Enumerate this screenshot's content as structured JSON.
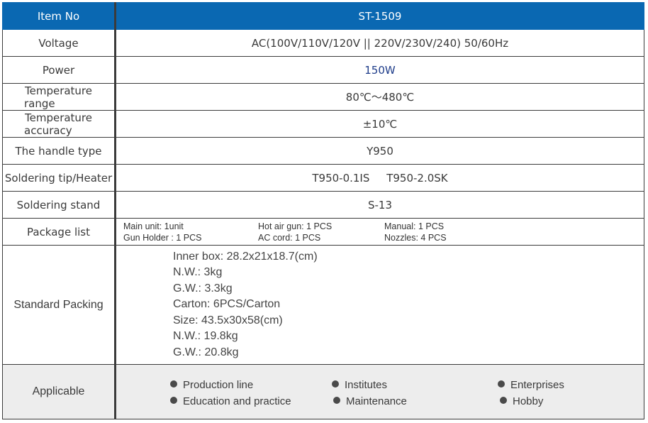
{
  "rows": {
    "item_no": {
      "label": "Item No",
      "value": "ST-1509"
    },
    "voltage": {
      "label": "Voltage",
      "value": "AC(100V/110V/120V || 220V/230V/240)  50/60Hz"
    },
    "power": {
      "label": "Power",
      "value": "150W"
    },
    "temp_range": {
      "label_line1": "Temperature",
      "label_line2": "range",
      "value": "80℃～480℃"
    },
    "temp_accuracy": {
      "label_line1": "Temperature",
      "label_line2": "accuracy",
      "value": "±10℃"
    },
    "handle_type": {
      "label": "The handle type",
      "value": "Y950"
    },
    "soldering_tip": {
      "label": "Soldering tip/Heater",
      "value": "T950-0.1IS     T950-2.0SK"
    },
    "soldering_stand": {
      "label": "Soldering stand",
      "value": "S-13"
    },
    "package_list": {
      "label": "Package list",
      "items": [
        "Main unit: 1unit",
        "Hot air gun: 1 PCS",
        "Manual: 1 PCS",
        "Gun Holder : 1 PCS",
        "AC cord: 1 PCS",
        "Nozzles: 4 PCS"
      ]
    },
    "standard_packing": {
      "label": "Standard Packing",
      "lines": [
        "Inner box: 28.2x21x18.7(cm)",
        "N.W.: 3kg",
        "G.W.: 3.3kg",
        "Carton: 6PCS/Carton",
        "Size: 43.5x30x58(cm)",
        "N.W.: 19.8kg",
        "G.W.: 20.8kg"
      ]
    },
    "applicable": {
      "label": "Applicable",
      "items": [
        "Production line",
        "Institutes",
        "Enterprises",
        "Education and practice",
        "Maintenance",
        "Hobby"
      ]
    }
  },
  "colors": {
    "header_bg": "#0a68b2",
    "applicable_bg": "#ededed",
    "power_value": "#1f3d8a"
  },
  "icons": {
    "bullet": "bullet-dot-icon"
  }
}
